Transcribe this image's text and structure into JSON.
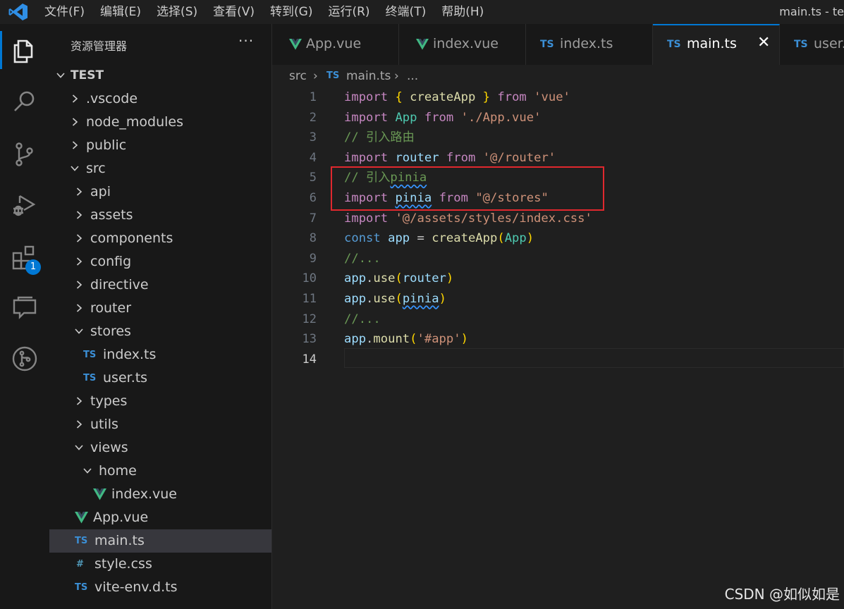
{
  "menu": [
    "文件(F)",
    "编辑(E)",
    "选择(S)",
    "查看(V)",
    "转到(G)",
    "运行(R)",
    "终端(T)",
    "帮助(H)"
  ],
  "window_title": "main.ts - te",
  "activity": {
    "extensions_badge": "1",
    "icons": [
      "explorer-icon",
      "search-icon",
      "source-control-icon",
      "run-debug-icon",
      "extensions-icon",
      "remote-explorer-icon",
      "git-graph-icon"
    ]
  },
  "sidebar": {
    "title": "资源管理器",
    "more": "···",
    "root": "TEST",
    "items": [
      {
        "label": ".vscode",
        "kind": "folder",
        "open": false
      },
      {
        "label": "node_modules",
        "kind": "folder",
        "open": false
      },
      {
        "label": "public",
        "kind": "folder",
        "open": false
      },
      {
        "label": "src",
        "kind": "folder",
        "open": true
      },
      {
        "label": "api",
        "kind": "folder",
        "open": false
      },
      {
        "label": "assets",
        "kind": "folder",
        "open": false
      },
      {
        "label": "components",
        "kind": "folder",
        "open": false
      },
      {
        "label": "config",
        "kind": "folder",
        "open": false
      },
      {
        "label": "directive",
        "kind": "folder",
        "open": false
      },
      {
        "label": "router",
        "kind": "folder",
        "open": false
      },
      {
        "label": "stores",
        "kind": "folder",
        "open": true
      },
      {
        "label": "index.ts",
        "kind": "ts"
      },
      {
        "label": "user.ts",
        "kind": "ts"
      },
      {
        "label": "types",
        "kind": "folder",
        "open": false
      },
      {
        "label": "utils",
        "kind": "folder",
        "open": false
      },
      {
        "label": "views",
        "kind": "folder",
        "open": true
      },
      {
        "label": "home",
        "kind": "folder",
        "open": true
      },
      {
        "label": "index.vue",
        "kind": "vue"
      },
      {
        "label": "App.vue",
        "kind": "vue"
      },
      {
        "label": "main.ts",
        "kind": "ts",
        "selected": true
      },
      {
        "label": "style.css",
        "kind": "css"
      },
      {
        "label": "vite-env.d.ts",
        "kind": "ts"
      }
    ],
    "ts_icon_text": "TS",
    "css_icon_text": "#"
  },
  "tabs": [
    {
      "label": "App.vue",
      "kind": "vue"
    },
    {
      "label": "index.vue",
      "kind": "vue"
    },
    {
      "label": "index.ts",
      "kind": "ts"
    },
    {
      "label": "main.ts",
      "kind": "ts",
      "active": true,
      "close": "✕"
    },
    {
      "label": "user.ts",
      "kind": "ts"
    }
  ],
  "breadcrumb": {
    "folder": "src",
    "sep": "›",
    "file": "main.ts",
    "ellipsis": "..."
  },
  "editor": {
    "line_numbers": [
      "1",
      "2",
      "3",
      "4",
      "5",
      "6",
      "7",
      "8",
      "9",
      "10",
      "11",
      "12",
      "13",
      "14"
    ],
    "current_line": "14",
    "lines": [
      "import { createApp } from 'vue'",
      "import App from './App.vue'",
      "// 引入路由",
      "import router from '@/router'",
      "// 引入pinia",
      "import pinia from \"@/stores\"",
      "import '@/assets/styles/index.css'",
      "const app = createApp(App)",
      "//...",
      "app.use(router)",
      "app.use(pinia)",
      "//...",
      "app.mount('#app')",
      ""
    ]
  },
  "colors": {
    "accent": "#0078d4",
    "highlight_box": "#e0282e",
    "vue_green": "#41b883",
    "ts_blue": "#3b8fd6"
  },
  "watermark": "CSDN @如似如是"
}
